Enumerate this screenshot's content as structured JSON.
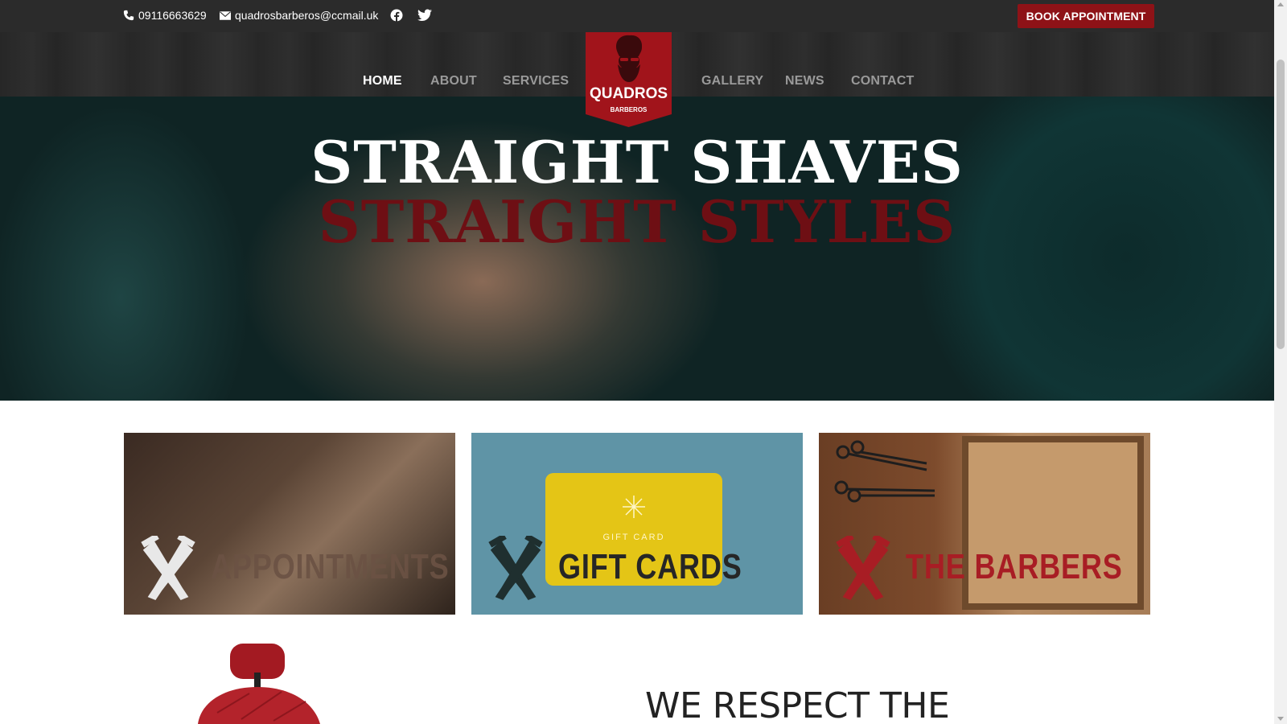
{
  "topbar": {
    "phone": "09116663629",
    "email": "quadrosbarberos@ccmail.uk",
    "phone_icon": "phone-icon",
    "email_icon": "envelope-icon",
    "social_icons": [
      "facebook-icon",
      "twitter-icon"
    ],
    "book_label": "BOOK APPOINTMENT"
  },
  "nav": {
    "items": [
      "HOME",
      "ABOUT",
      "SERVICES",
      "GALLERY",
      "NEWS",
      "CONTACT"
    ],
    "active": "HOME"
  },
  "logo": {
    "name": "QUADROS",
    "sub": "BARBEROS",
    "icon": "bearded-man-logo"
  },
  "hero": {
    "line1": "STRAIGHT SHAVES",
    "line2": "STRAIGHT STYLES"
  },
  "cards": [
    {
      "label": "APPOINTMENTS",
      "icon": "crossed-clippers-icon"
    },
    {
      "label": "GIFT CARDS",
      "icon": "crossed-clippers-icon",
      "card_text": "GIFT CARD"
    },
    {
      "label": "THE BARBERS",
      "icon": "crossed-clippers-icon"
    }
  ],
  "section": {
    "heading": "WE RESPECT THE"
  },
  "colors": {
    "topbar_bg": "#2b2b2b",
    "accent_red": "#8e1217",
    "hero_dark_red": "#6e0f14",
    "barbers_red": "#a81d24"
  }
}
